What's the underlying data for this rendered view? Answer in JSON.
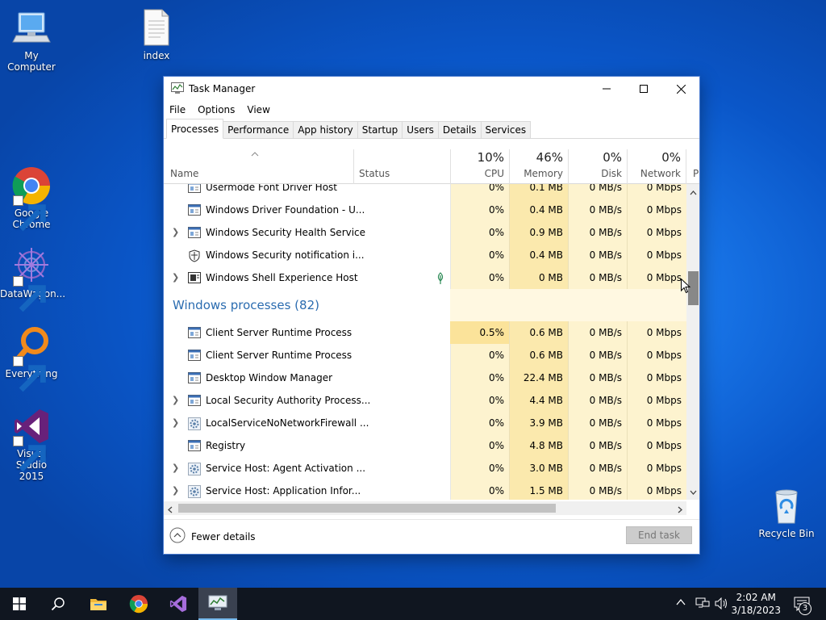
{
  "desktop": {
    "icons": [
      {
        "label": "My Computer",
        "icon": "computer-icon"
      },
      {
        "label": "index",
        "icon": "document-icon"
      },
      {
        "label": "Google Chrome",
        "icon": "chrome-icon"
      },
      {
        "label": "DataWagon...",
        "icon": "datawagon-icon"
      },
      {
        "label": "Everything",
        "icon": "everything-search-icon"
      },
      {
        "label": "Visual Studio 2015",
        "icon": "visual-studio-icon"
      },
      {
        "label": "Recycle Bin",
        "icon": "recycle-bin-icon"
      }
    ]
  },
  "window": {
    "title": "Task Manager",
    "menu": [
      "File",
      "Options",
      "View"
    ],
    "tabs": [
      "Processes",
      "Performance",
      "App history",
      "Startup",
      "Users",
      "Details",
      "Services"
    ],
    "active_tab": "Processes",
    "columns": {
      "name": "Name",
      "status": "Status",
      "cpu": {
        "pct": "10%",
        "label": "CPU"
      },
      "memory": {
        "pct": "46%",
        "label": "Memory"
      },
      "disk": {
        "pct": "0%",
        "label": "Disk"
      },
      "network": {
        "pct": "0%",
        "label": "Network"
      },
      "next_partial": "P"
    },
    "rows_top": [
      {
        "name": "Usermode Font Driver Host",
        "expand": false,
        "icon": "process-window-icon",
        "cpu": "0%",
        "memory": "0.1 MB",
        "disk": "0 MB/s",
        "network": "0 Mbps"
      },
      {
        "name": "Windows Driver Foundation - U...",
        "expand": false,
        "icon": "process-window-icon",
        "cpu": "0%",
        "memory": "0.4 MB",
        "disk": "0 MB/s",
        "network": "0 Mbps"
      },
      {
        "name": "Windows Security Health Service",
        "expand": true,
        "icon": "process-window-icon",
        "cpu": "0%",
        "memory": "0.9 MB",
        "disk": "0 MB/s",
        "network": "0 Mbps"
      },
      {
        "name": "Windows Security notification i...",
        "expand": false,
        "icon": "shield-icon",
        "cpu": "0%",
        "memory": "0.4 MB",
        "disk": "0 MB/s",
        "network": "0 Mbps"
      },
      {
        "name": "Windows Shell Experience Host",
        "expand": true,
        "icon": "shell-window-icon",
        "status_icon": "leaf-icon",
        "cpu": "0%",
        "memory": "0 MB",
        "disk": "0 MB/s",
        "network": "0 Mbps"
      }
    ],
    "group": {
      "title": "Windows processes (82)"
    },
    "rows_windows": [
      {
        "name": "Client Server Runtime Process",
        "expand": false,
        "icon": "process-window-icon",
        "cpu": "0.5%",
        "memory": "0.6 MB",
        "disk": "0 MB/s",
        "network": "0 Mbps"
      },
      {
        "name": "Client Server Runtime Process",
        "expand": false,
        "icon": "process-window-icon",
        "cpu": "0%",
        "memory": "0.6 MB",
        "disk": "0 MB/s",
        "network": "0 Mbps"
      },
      {
        "name": "Desktop Window Manager",
        "expand": false,
        "icon": "process-window-icon",
        "cpu": "0%",
        "memory": "22.4 MB",
        "disk": "0 MB/s",
        "network": "0 Mbps"
      },
      {
        "name": "Local Security Authority Process...",
        "expand": true,
        "icon": "process-window-icon",
        "cpu": "0%",
        "memory": "4.4 MB",
        "disk": "0 MB/s",
        "network": "0 Mbps"
      },
      {
        "name": "LocalServiceNoNetworkFirewall ...",
        "expand": true,
        "icon": "gear-icon",
        "cpu": "0%",
        "memory": "3.9 MB",
        "disk": "0 MB/s",
        "network": "0 Mbps"
      },
      {
        "name": "Registry",
        "expand": false,
        "icon": "process-window-icon",
        "cpu": "0%",
        "memory": "4.8 MB",
        "disk": "0 MB/s",
        "network": "0 Mbps"
      },
      {
        "name": "Service Host: Agent Activation ...",
        "expand": true,
        "icon": "gear-icon",
        "cpu": "0%",
        "memory": "3.0 MB",
        "disk": "0 MB/s",
        "network": "0 Mbps"
      },
      {
        "name": "Service Host: Application Infor...",
        "expand": true,
        "icon": "gear-icon",
        "cpu": "0%",
        "memory": "1.5 MB",
        "disk": "0 MB/s",
        "network": "0 Mbps"
      }
    ],
    "footer": {
      "fewer_details": "Fewer details",
      "end_task": "End task"
    }
  },
  "taskbar": {
    "items": [
      "start-icon",
      "search-icon",
      "file-explorer-icon",
      "chrome-icon",
      "visual-studio-icon",
      "task-manager-icon"
    ],
    "clock": {
      "time": "2:02 AM",
      "date": "3/18/2023"
    },
    "notifications_count": "3"
  },
  "colors": {
    "cpu_cell": "#fdf1c6",
    "memory_cell": "#fbe7a6",
    "group_title": "#2b6cb0",
    "desktop_blue": "#1773e6"
  }
}
